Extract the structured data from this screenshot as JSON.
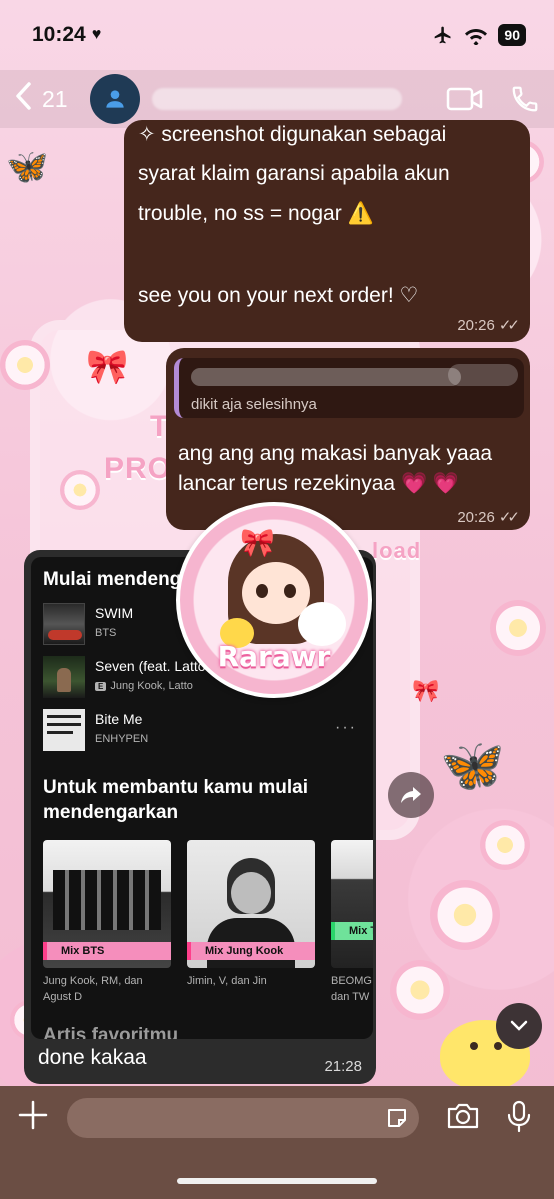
{
  "status_bar": {
    "time": "10:24",
    "battery": "90"
  },
  "header": {
    "back_count": "21"
  },
  "messages": {
    "m1": {
      "lines": [
        "✧ screenshot digunakan sebagai",
        "syarat klaim garansi apabila akun",
        "trouble, no ss = nogar ⚠️",
        "see you on your next order! ♡"
      ],
      "time": "20:26"
    },
    "m2": {
      "quote_text": "dikit aja selesihnya",
      "lines": [
        "ang ang ang makasi banyak yaaa",
        "lancar terus rezekinyaa 💗 💗"
      ],
      "time": "20:26"
    },
    "m3": {
      "caption": "done kakaa",
      "time": "21:28",
      "screenshot": {
        "section1": "Mulai mendeng",
        "tracks": [
          {
            "title": "SWIM",
            "artist": "BTS",
            "explicit": false
          },
          {
            "title": "Seven (feat. Latto",
            "artist": "Jung Kook, Latto",
            "explicit": true,
            "badge": "E"
          },
          {
            "title": "Bite Me",
            "artist": "ENHYPEN",
            "explicit": false
          }
        ],
        "section2_l1": "Untuk membantu kamu mulai",
        "section2_l2": "mendengarkan",
        "cards": [
          {
            "tag": "Mix BTS",
            "sub_l1": "Jung Kook, RM, dan",
            "sub_l2": "Agust D"
          },
          {
            "tag": "Mix Jung Kook",
            "sub_l1": "Jimin, V, dan Jin",
            "sub_l2": ""
          },
          {
            "tag": "Mix T",
            "sub_l1": "BEOMG",
            "sub_l2": "dan TW"
          }
        ],
        "section3": "Artis favoritmu"
      }
    }
  },
  "wallpaper": {
    "text1": "T",
    "text2": "PRO",
    "text3": "load"
  },
  "sticker": {
    "label": "Rarawr"
  },
  "colors": {
    "bubble": "#45261c",
    "input_bar": "#6b4e44",
    "tag": "#f58ebc"
  }
}
